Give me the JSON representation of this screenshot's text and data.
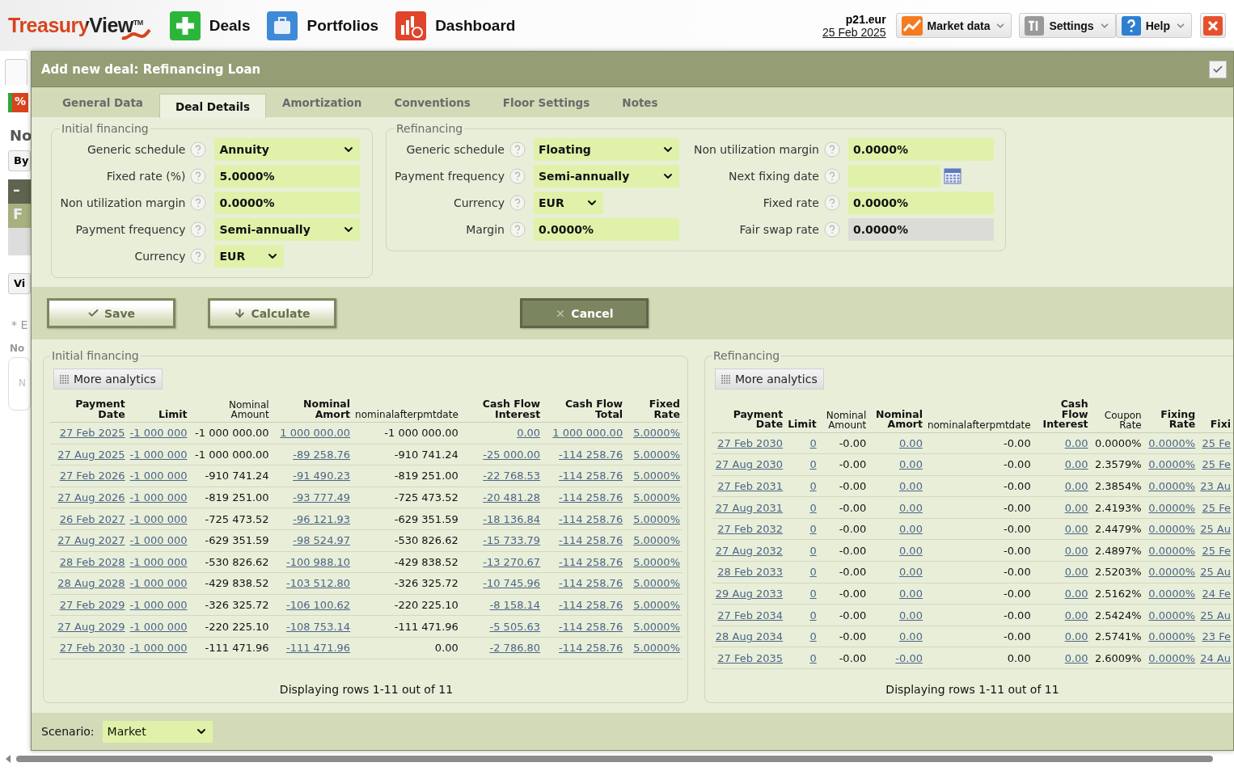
{
  "app_header": {
    "logo": "TreasuryView$^{TM}$",
    "nav": [
      {
        "label": "Deals",
        "kind": "deals"
      },
      {
        "label": "Portfolios",
        "kind": "portfolios"
      },
      {
        "label": "Dashboard",
        "kind": "dashboard"
      }
    ],
    "user": "p21.eur",
    "date": "25 Feb 2025",
    "menus": [
      {
        "label": "Market data",
        "kind": "market"
      },
      {
        "label": "Settings",
        "kind": "settings"
      },
      {
        "label": "Help",
        "kind": "help"
      }
    ]
  },
  "background_page": [
    {
      "kind": "tab"
    },
    {
      "kind": "percent",
      "text": "%"
    },
    {
      "kind": "heading",
      "text": "No"
    },
    {
      "kind": "button",
      "text": "By"
    },
    {
      "kind": "dark_bar",
      "text": "–"
    },
    {
      "kind": "green_bar",
      "text": "F"
    },
    {
      "kind": "button",
      "text": "Vi"
    },
    {
      "kind": "note",
      "text": "* E"
    },
    {
      "kind": "label",
      "text": "No"
    },
    {
      "kind": "box",
      "text": "N"
    }
  ],
  "dialog": {
    "title": "Add new deal: Refinancing Loan",
    "tabs": [
      {
        "label": "General Data",
        "selected": false
      },
      {
        "label": "Deal Details",
        "selected": true
      },
      {
        "label": "Amortization",
        "selected": false
      },
      {
        "label": "Conventions",
        "selected": false
      },
      {
        "label": "Floor Settings",
        "selected": false
      },
      {
        "label": "Notes",
        "selected": false
      }
    ],
    "initial_financing": {
      "legend": "Initial financing",
      "fields": [
        {
          "label": "Generic schedule",
          "kind": "select",
          "value": "Annuity"
        },
        {
          "label": "Fixed rate (%)",
          "kind": "input",
          "value": "5.0000%"
        },
        {
          "label": "Non utilization margin",
          "kind": "input",
          "value": "0.0000%"
        },
        {
          "label": "Payment frequency",
          "kind": "select",
          "value": "Semi-annually"
        },
        {
          "label": "Currency",
          "kind": "short_select",
          "value": "EUR"
        }
      ]
    },
    "refinancing": {
      "legend": "Refinancing",
      "columns": [
        [
          {
            "label": "Generic schedule",
            "kind": "select",
            "value": "Floating"
          },
          {
            "label": "Payment frequency",
            "kind": "select",
            "value": "Semi-annually"
          },
          {
            "label": "Currency",
            "kind": "short_select",
            "value": "EUR"
          },
          {
            "label": "Margin",
            "kind": "input",
            "value": "0.0000%"
          }
        ],
        [
          {
            "label": "Non utilization margin",
            "kind": "input",
            "value": "0.0000%"
          },
          {
            "label": "Next fixing date",
            "kind": "date"
          },
          {
            "label": "Fixed rate",
            "kind": "input",
            "value": "0.0000%"
          },
          {
            "label": "Fair swap rate",
            "kind": "readonly",
            "value": "0.0000%"
          }
        ]
      ]
    },
    "buttons": [
      {
        "label": "Save",
        "kind": "save"
      },
      {
        "label": "Calculate",
        "kind": "calculate"
      },
      {
        "label": "Cancel",
        "kind": "cancel"
      }
    ],
    "tables": [
      {
        "legend": "Initial financing",
        "analytics_button": "More analytics",
        "columns": [
          {
            "label": "Payment Date",
            "link": true
          },
          {
            "label": "Limit",
            "link": true
          },
          {
            "label": "Nominal Amount",
            "link": false
          },
          {
            "label": "Nominal Amort",
            "link": true
          },
          {
            "label": "nominalafterpmtdate",
            "link": false
          },
          {
            "label": "Cash Flow Interest",
            "link": true
          },
          {
            "label": "Cash Flow Total",
            "link": true
          },
          {
            "label": "Fixed Rate",
            "link": true
          }
        ],
        "rows": [
          [
            "27 Feb 2025",
            "-1 000 000",
            "-1 000 000.00",
            "1 000 000.00",
            "-1 000 000.00",
            "0.00",
            "1 000 000.00",
            "5.0000%"
          ],
          [
            "27 Aug 2025",
            "-1 000 000",
            "-1 000 000.00",
            "-89 258.76",
            "-910 741.24",
            "-25 000.00",
            "-114 258.76",
            "5.0000%"
          ],
          [
            "27 Feb 2026",
            "-1 000 000",
            "-910 741.24",
            "-91 490.23",
            "-819 251.00",
            "-22 768.53",
            "-114 258.76",
            "5.0000%"
          ],
          [
            "27 Aug 2026",
            "-1 000 000",
            "-819 251.00",
            "-93 777.49",
            "-725 473.52",
            "-20 481.28",
            "-114 258.76",
            "5.0000%"
          ],
          [
            "26 Feb 2027",
            "-1 000 000",
            "-725 473.52",
            "-96 121.93",
            "-629 351.59",
            "-18 136.84",
            "-114 258.76",
            "5.0000%"
          ],
          [
            "27 Aug 2027",
            "-1 000 000",
            "-629 351.59",
            "-98 524.97",
            "-530 826.62",
            "-15 733.79",
            "-114 258.76",
            "5.0000%"
          ],
          [
            "28 Feb 2028",
            "-1 000 000",
            "-530 826.62",
            "-100 988.10",
            "-429 838.52",
            "-13 270.67",
            "-114 258.76",
            "5.0000%"
          ],
          [
            "28 Aug 2028",
            "-1 000 000",
            "-429 838.52",
            "-103 512.80",
            "-326 325.72",
            "-10 745.96",
            "-114 258.76",
            "5.0000%"
          ],
          [
            "27 Feb 2029",
            "-1 000 000",
            "-326 325.72",
            "-106 100.62",
            "-220 225.10",
            "-8 158.14",
            "-114 258.76",
            "5.0000%"
          ],
          [
            "27 Aug 2029",
            "-1 000 000",
            "-220 225.10",
            "-108 753.14",
            "-111 471.96",
            "-5 505.63",
            "-114 258.76",
            "5.0000%"
          ],
          [
            "27 Feb 2030",
            "-1 000 000",
            "-111 471.96",
            "-111 471.96",
            "0.00",
            "-2 786.80",
            "-114 258.76",
            "5.0000%"
          ]
        ],
        "footer": "Displaying rows 1-11 out of 11"
      },
      {
        "legend": "Refinancing",
        "analytics_button": "More analytics",
        "columns": [
          {
            "label": "Payment Date",
            "link": true
          },
          {
            "label": "Limit",
            "link": true
          },
          {
            "label": "Nominal Amount",
            "link": false
          },
          {
            "label": "Nominal Amort",
            "link": true
          },
          {
            "label": "nominalafterpmtdate",
            "link": false
          },
          {
            "label": "Cash Flow Interest",
            "link": true
          },
          {
            "label": "Coupon Rate",
            "link": false
          },
          {
            "label": "Fixing Rate",
            "link": true
          },
          {
            "label": "Fixi",
            "link": true
          }
        ],
        "rows": [
          [
            "27 Feb 2030",
            "0",
            "-0.00",
            "0.00",
            "-0.00",
            "0.00",
            "0.0000%",
            "0.0000%",
            "25 Fe"
          ],
          [
            "27 Aug 2030",
            "0",
            "-0.00",
            "0.00",
            "-0.00",
            "0.00",
            "2.3579%",
            "0.0000%",
            "25 Fe"
          ],
          [
            "27 Feb 2031",
            "0",
            "-0.00",
            "0.00",
            "-0.00",
            "0.00",
            "2.3854%",
            "0.0000%",
            "23 Au"
          ],
          [
            "27 Aug 2031",
            "0",
            "-0.00",
            "0.00",
            "-0.00",
            "0.00",
            "2.4193%",
            "0.0000%",
            "25 Fe"
          ],
          [
            "27 Feb 2032",
            "0",
            "-0.00",
            "0.00",
            "-0.00",
            "0.00",
            "2.4479%",
            "0.0000%",
            "25 Au"
          ],
          [
            "27 Aug 2032",
            "0",
            "-0.00",
            "0.00",
            "-0.00",
            "0.00",
            "2.4897%",
            "0.0000%",
            "25 Fe"
          ],
          [
            "28 Feb 2033",
            "0",
            "-0.00",
            "0.00",
            "-0.00",
            "0.00",
            "2.5203%",
            "0.0000%",
            "25 Au"
          ],
          [
            "29 Aug 2033",
            "0",
            "-0.00",
            "0.00",
            "-0.00",
            "0.00",
            "2.5162%",
            "0.0000%",
            "24 Fe"
          ],
          [
            "27 Feb 2034",
            "0",
            "-0.00",
            "0.00",
            "-0.00",
            "0.00",
            "2.5424%",
            "0.0000%",
            "25 Au"
          ],
          [
            "28 Aug 2034",
            "0",
            "-0.00",
            "0.00",
            "-0.00",
            "0.00",
            "2.5741%",
            "0.0000%",
            "23 Fe"
          ],
          [
            "27 Feb 2035",
            "0",
            "-0.00",
            "-0.00",
            "0.00",
            "0.00",
            "2.6009%",
            "0.0000%",
            "24 Au"
          ]
        ],
        "footer": "Displaying rows 1-11 out of 11"
      }
    ],
    "scenario": {
      "label": "Scenario:",
      "value": "Market"
    }
  }
}
